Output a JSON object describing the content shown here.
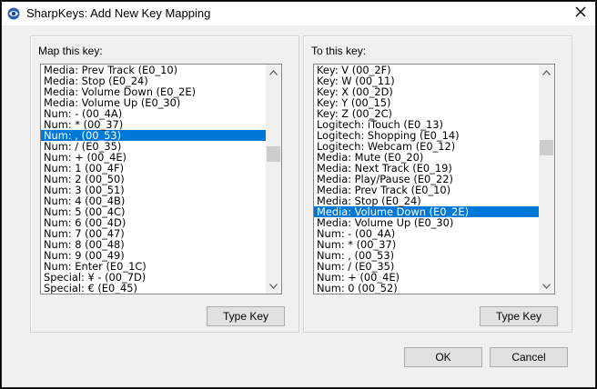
{
  "window": {
    "title": "SharpKeys: Add New Key Mapping",
    "ok_label": "OK",
    "cancel_label": "Cancel"
  },
  "icons": {
    "app": "sharpkeys-app-icon",
    "close": "close-icon",
    "scroll_up": "scroll-up-arrow-icon",
    "scroll_down": "scroll-down-arrow-icon"
  },
  "colors": {
    "selection": "#0078d7",
    "window_bg": "#f0f0f0"
  },
  "map_panel": {
    "label": "Map this key:",
    "type_key_label": "Type Key",
    "selected_index": 6,
    "items": [
      "Media: Prev Track (E0_10)",
      "Media: Stop (E0_24)",
      "Media: Volume Down (E0_2E)",
      "Media: Volume Up (E0_30)",
      "Num: - (00_4A)",
      "Num: * (00_37)",
      "Num: , (00_53)",
      "Num: / (E0_35)",
      "Num: + (00_4E)",
      "Num: 1 (00_4F)",
      "Num: 2 (00_50)",
      "Num: 3 (00_51)",
      "Num: 4 (00_4B)",
      "Num: 5 (00_4C)",
      "Num: 6 (00_4D)",
      "Num: 7 (00_47)",
      "Num: 8 (00_48)",
      "Num: 9 (00_49)",
      "Num: Enter (E0_1C)",
      "Special: ¥ - (00_7D)",
      "Special: € (E0_45)"
    ]
  },
  "to_panel": {
    "label": "To this key:",
    "type_key_label": "Type Key",
    "selected_index": 13,
    "items": [
      "Key: V (00_2F)",
      "Key: W (00_11)",
      "Key: X (00_2D)",
      "Key: Y (00_15)",
      "Key: Z (00_2C)",
      "Logitech: iTouch (E0_13)",
      "Logitech: Shopping (E0_14)",
      "Logitech: Webcam (E0_12)",
      "Media: Mute (E0_20)",
      "Media: Next Track (E0_19)",
      "Media: Play/Pause (E0_22)",
      "Media: Prev Track (E0_10)",
      "Media: Stop (E0_24)",
      "Media: Volume Down (E0_2E)",
      "Media: Volume Up (E0_30)",
      "Num: - (00_4A)",
      "Num: * (00_37)",
      "Num: , (00_53)",
      "Num: / (E0_35)",
      "Num: + (00_4E)",
      "Num: 0 (00_52)"
    ]
  }
}
